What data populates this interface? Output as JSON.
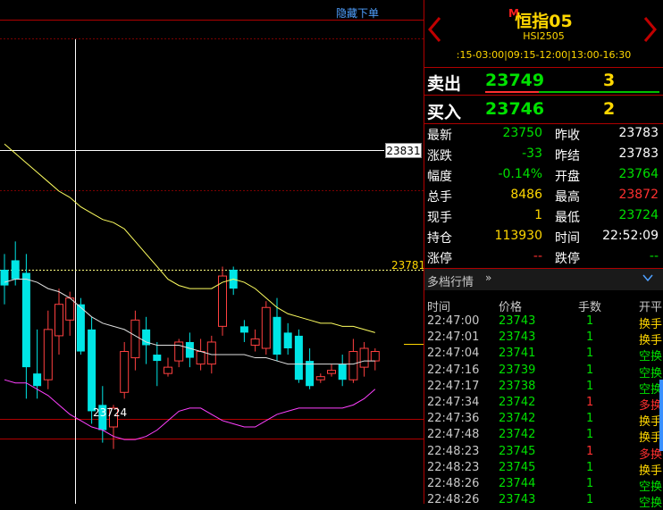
{
  "toolbar": {
    "hide_orders": "隐藏下单"
  },
  "chart": {
    "price_tag_current": "23831",
    "price_tag_limit": "23781",
    "low_label": "23724",
    "candles": [
      {
        "o": 23781,
        "h": 23786,
        "l": 23770,
        "c": 23776
      },
      {
        "o": 23784,
        "h": 23790,
        "l": 23776,
        "c": 23778
      },
      {
        "o": 23780,
        "h": 23786,
        "l": 23740,
        "c": 23750
      },
      {
        "o": 23748,
        "h": 23762,
        "l": 23740,
        "c": 23744
      },
      {
        "o": 23746,
        "h": 23768,
        "l": 23743,
        "c": 23762
      },
      {
        "o": 23760,
        "h": 23775,
        "l": 23754,
        "c": 23770
      },
      {
        "o": 23765,
        "h": 23774,
        "l": 23760,
        "c": 23772
      },
      {
        "o": 23770,
        "h": 23772,
        "l": 23754,
        "c": 23755
      },
      {
        "o": 23762,
        "h": 23766,
        "l": 23732,
        "c": 23736
      },
      {
        "o": 23738,
        "h": 23744,
        "l": 23726,
        "c": 23730
      },
      {
        "o": 23731,
        "h": 23738,
        "l": 23724,
        "c": 23737
      },
      {
        "o": 23742,
        "h": 23758,
        "l": 23740,
        "c": 23755
      },
      {
        "o": 23753,
        "h": 23768,
        "l": 23749,
        "c": 23765
      },
      {
        "o": 23762,
        "h": 23766,
        "l": 23751,
        "c": 23757
      },
      {
        "o": 23754,
        "h": 23758,
        "l": 23744,
        "c": 23752
      },
      {
        "o": 23748,
        "h": 23753,
        "l": 23747,
        "c": 23750
      },
      {
        "o": 23752,
        "h": 23759,
        "l": 23750,
        "c": 23758
      },
      {
        "o": 23758,
        "h": 23761,
        "l": 23750,
        "c": 23753
      },
      {
        "o": 23751,
        "h": 23759,
        "l": 23749,
        "c": 23755
      },
      {
        "o": 23751,
        "h": 23760,
        "l": 23748,
        "c": 23758
      },
      {
        "o": 23763,
        "h": 23782,
        "l": 23760,
        "c": 23779
      },
      {
        "o": 23781,
        "h": 23782,
        "l": 23773,
        "c": 23775
      },
      {
        "o": 23763,
        "h": 23765,
        "l": 23758,
        "c": 23761
      },
      {
        "o": 23757,
        "h": 23762,
        "l": 23755,
        "c": 23759
      },
      {
        "o": 23756,
        "h": 23771,
        "l": 23754,
        "c": 23769
      },
      {
        "o": 23766,
        "h": 23772,
        "l": 23752,
        "c": 23754
      },
      {
        "o": 23761,
        "h": 23764,
        "l": 23754,
        "c": 23756
      },
      {
        "o": 23760,
        "h": 23762,
        "l": 23745,
        "c": 23746
      },
      {
        "o": 23752,
        "h": 23756,
        "l": 23743,
        "c": 23744
      },
      {
        "o": 23746,
        "h": 23748,
        "l": 23745,
        "c": 23747
      },
      {
        "o": 23748,
        "h": 23751,
        "l": 23747,
        "c": 23749
      },
      {
        "o": 23751,
        "h": 23754,
        "l": 23744,
        "c": 23746
      },
      {
        "o": 23746,
        "h": 23759,
        "l": 23745,
        "c": 23755
      },
      {
        "o": 23750,
        "h": 23758,
        "l": 23747,
        "c": 23756
      },
      {
        "o": 23752,
        "h": 23756,
        "l": 23749,
        "c": 23755
      }
    ],
    "ma_upper": [
      23821,
      23818,
      23815,
      23812,
      23809,
      23806,
      23804,
      23801,
      23799,
      23797,
      23796,
      23794,
      23790,
      23786,
      23782,
      23778,
      23776,
      23775,
      23775,
      23775,
      23777,
      23778,
      23777,
      23775,
      23772,
      23769,
      23767,
      23766,
      23765,
      23764,
      23764,
      23763,
      23763,
      23762,
      23761
    ],
    "ma_mid": [
      23777,
      23778,
      23778,
      23777,
      23775,
      23774,
      23772,
      23769,
      23766,
      23764,
      23763,
      23762,
      23760,
      23758,
      23757,
      23757,
      23757,
      23756,
      23755,
      23754,
      23754,
      23754,
      23754,
      23753,
      23753,
      23752,
      23751,
      23751,
      23751,
      23751,
      23751,
      23751,
      23751,
      23752,
      23752
    ],
    "ma_lower": [
      23746,
      23745,
      23745,
      23743,
      23741,
      23738,
      23735,
      23733,
      23731,
      23730,
      23728,
      23727,
      23727,
      23728,
      23730,
      23733,
      23736,
      23737,
      23737,
      23735,
      23733,
      23732,
      23731,
      23731,
      23733,
      23735,
      23736,
      23737,
      23737,
      23737,
      23737,
      23737,
      23738,
      23740,
      23743
    ]
  },
  "header": {
    "mtag": "M",
    "name": "恒指05",
    "code": "HSI2505",
    "sessions": ":15-03:00|09:15-12:00|13:00-16:30"
  },
  "quotes": {
    "ask_label": "卖出",
    "ask_price": "23749",
    "ask_vol": "3",
    "bid_label": "买入",
    "bid_price": "23746",
    "bid_vol": "2"
  },
  "stats_left": [
    {
      "k": "最新",
      "v": "23750",
      "c": "g"
    },
    {
      "k": "涨跌",
      "v": "-33",
      "c": "g"
    },
    {
      "k": "幅度",
      "v": "-0.14%",
      "c": "g"
    },
    {
      "k": "总手",
      "v": "8486",
      "c": "y"
    },
    {
      "k": "现手",
      "v": "1",
      "c": "y"
    },
    {
      "k": "持仓",
      "v": "113930",
      "c": "y"
    },
    {
      "k": "涨停",
      "v": "--",
      "c": "r"
    }
  ],
  "stats_right": [
    {
      "k": "昨收",
      "v": "23783",
      "c": "w"
    },
    {
      "k": "昨结",
      "v": "23783",
      "c": "w"
    },
    {
      "k": "开盘",
      "v": "23764",
      "c": "g"
    },
    {
      "k": "最高",
      "v": "23872",
      "c": "r"
    },
    {
      "k": "最低",
      "v": "23724",
      "c": "g"
    },
    {
      "k": "时间",
      "v": "22:52:09",
      "c": "w"
    },
    {
      "k": "跌停",
      "v": "--",
      "c": "g"
    }
  ],
  "depth": {
    "title": "多档行情"
  },
  "ticks_header": {
    "time": "时间",
    "price": "价格",
    "qty": "手数",
    "kind": "开平"
  },
  "ticks": [
    {
      "time": "22:47:00",
      "price": "23743",
      "qty": "1",
      "qc": "g",
      "kind": "换手",
      "kc": "y"
    },
    {
      "time": "22:47:01",
      "price": "23743",
      "qty": "1",
      "qc": "g",
      "kind": "换手",
      "kc": "y"
    },
    {
      "time": "22:47:04",
      "price": "23741",
      "qty": "1",
      "qc": "g",
      "kind": "空换",
      "kc": "g"
    },
    {
      "time": "22:47:16",
      "price": "23739",
      "qty": "1",
      "qc": "g",
      "kind": "空换",
      "kc": "g"
    },
    {
      "time": "22:47:17",
      "price": "23738",
      "qty": "1",
      "qc": "g",
      "kind": "空换",
      "kc": "g"
    },
    {
      "time": "22:47:34",
      "price": "23742",
      "qty": "1",
      "qc": "r",
      "kind": "多换",
      "kc": "r"
    },
    {
      "time": "22:47:36",
      "price": "23742",
      "qty": "1",
      "qc": "g",
      "kind": "换手",
      "kc": "y"
    },
    {
      "time": "22:47:48",
      "price": "23742",
      "qty": "1",
      "qc": "g",
      "kind": "换手",
      "kc": "y"
    },
    {
      "time": "22:48:23",
      "price": "23745",
      "qty": "1",
      "qc": "r",
      "kind": "多换",
      "kc": "r"
    },
    {
      "time": "22:48:23",
      "price": "23745",
      "qty": "1",
      "qc": "g",
      "kind": "换手",
      "kc": "y"
    },
    {
      "time": "22:48:26",
      "price": "23744",
      "qty": "1",
      "qc": "g",
      "kind": "空换",
      "kc": "g"
    },
    {
      "time": "22:48:26",
      "price": "23743",
      "qty": "1",
      "qc": "g",
      "kind": "空换",
      "kc": "g"
    }
  ]
}
